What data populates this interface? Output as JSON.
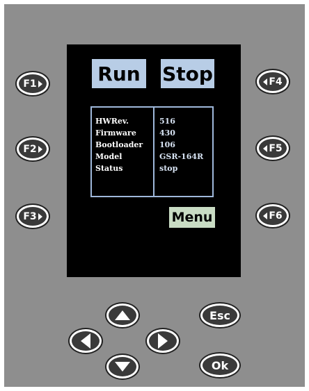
{
  "screen": {
    "run_label": "Run",
    "stop_label": "Stop",
    "menu_label": "Menu",
    "info": {
      "rows": [
        {
          "label": "HWRev.",
          "value": "516"
        },
        {
          "label": "Firmware",
          "value": "430"
        },
        {
          "label": "Bootloader",
          "value": "106"
        },
        {
          "label": "Model",
          "value": "GSR-164R"
        },
        {
          "label": "Status",
          "value": "stop"
        }
      ]
    }
  },
  "function_keys": {
    "f1": "F1",
    "f2": "F2",
    "f3": "F3",
    "f4": "F4",
    "f5": "F5",
    "f6": "F6"
  },
  "keypad": {
    "esc_label": "Esc",
    "ok_label": "Ok",
    "up_icon": "arrow-up-icon",
    "down_icon": "arrow-down-icon",
    "left_icon": "arrow-left-icon",
    "right_icon": "arrow-right-icon"
  },
  "colors": {
    "panel": "#8e8e8e",
    "screen": "#000000",
    "run_stop_tile": "#b8cde6",
    "menu_tile": "#c9dcc4",
    "info_border": "#9fb8db"
  }
}
